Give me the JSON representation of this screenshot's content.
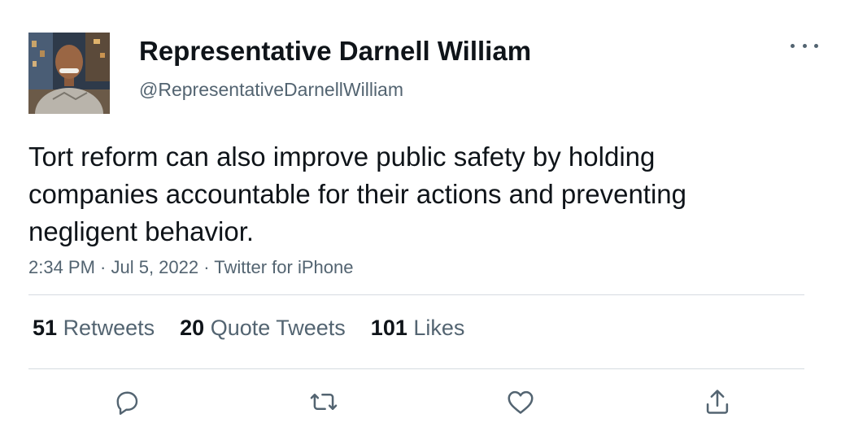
{
  "author": {
    "name": "Representative Darnell William",
    "handle": "@RepresentativeDarnellWilliam"
  },
  "tweet": {
    "text": "Tort reform can also improve public safety by holding companies accountable for their actions and preventing negligent behavior.",
    "meta": "2:34 PM · Jul 5, 2022 · Twitter for iPhone"
  },
  "stats": {
    "retweets": {
      "count": "51",
      "label": "Retweets"
    },
    "quotes": {
      "count": "20",
      "label": "Quote Tweets"
    },
    "likes": {
      "count": "101",
      "label": "Likes"
    }
  },
  "icons": {
    "more": "more-options-icon",
    "reply": "reply-icon",
    "retweet": "retweet-icon",
    "like": "heart-icon",
    "share": "share-icon"
  },
  "colors": {
    "text": "#0f1419",
    "secondary": "#536471",
    "divider": "#d5dbe0"
  }
}
